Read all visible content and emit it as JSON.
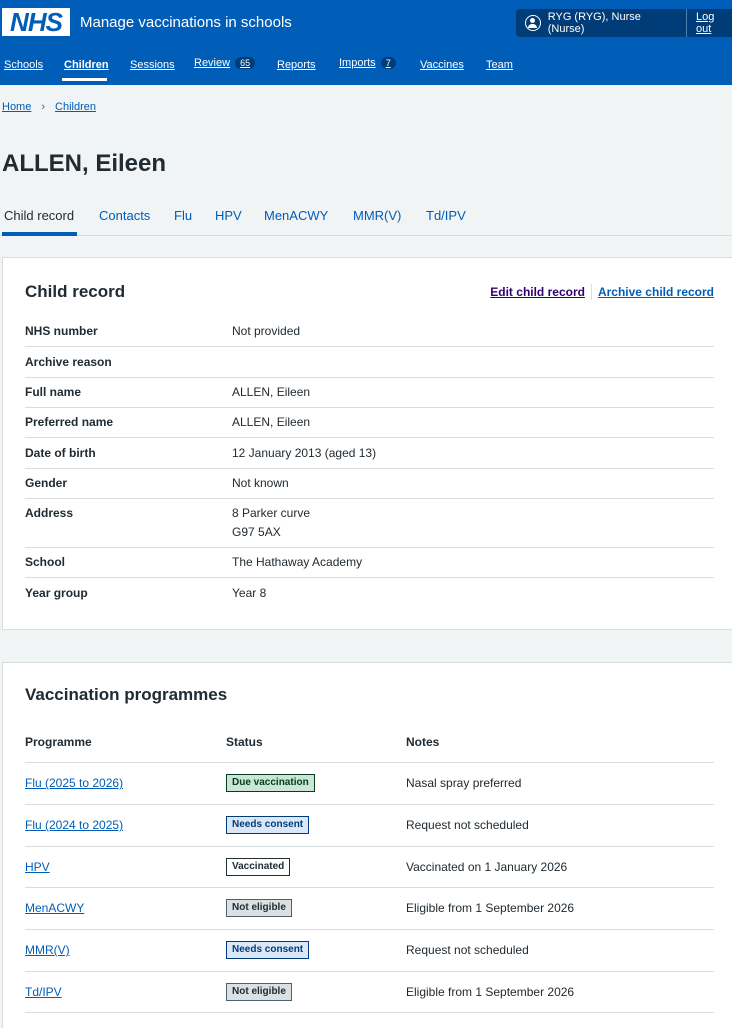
{
  "header": {
    "logo": "NHS",
    "service_name": "Manage vaccinations in schools",
    "account_name": "RYG (RYG), Nurse (Nurse)",
    "logout_label": "Log out"
  },
  "nav": {
    "items": [
      {
        "label": "Schools"
      },
      {
        "label": "Children"
      },
      {
        "label": "Sessions"
      },
      {
        "label": "Review",
        "count": "65"
      },
      {
        "label": "Reports"
      },
      {
        "label": "Imports",
        "count": "7"
      },
      {
        "label": "Vaccines"
      },
      {
        "label": "Team"
      }
    ]
  },
  "breadcrumb": {
    "home": "Home",
    "children": "Children"
  },
  "page_title": "ALLEN, Eileen",
  "tabs": [
    "Child record",
    "Contacts",
    "Flu",
    "HPV",
    "MenACWY",
    "MMR(V)",
    "Td/IPV"
  ],
  "child_record": {
    "title": "Child record",
    "edit_label": "Edit child record",
    "archive_label": "Archive child record",
    "rows": [
      {
        "key": "NHS number",
        "value": "Not provided"
      },
      {
        "key": "Archive reason",
        "value": ""
      },
      {
        "key": "Full name",
        "value": "ALLEN, Eileen"
      },
      {
        "key": "Preferred name",
        "value": "ALLEN, Eileen"
      },
      {
        "key": "Date of birth",
        "value": "12 January 2013 (aged 13)"
      },
      {
        "key": "Gender",
        "value": "Not known"
      },
      {
        "key": "Address",
        "value": "8 Parker curve",
        "value2": "G97 5AX"
      },
      {
        "key": "School",
        "value": "The Hathaway Academy"
      },
      {
        "key": "Year group",
        "value": "Year 8"
      }
    ]
  },
  "programmes": {
    "title": "Vaccination programmes",
    "headers": {
      "programme": "Programme",
      "status": "Status",
      "notes": "Notes"
    },
    "rows": [
      {
        "programme": "Flu (2025 to 2026)",
        "status": "Due vaccination",
        "notes": "Nasal spray preferred",
        "tag_color": "#cce5d6"
      },
      {
        "programme": "Flu (2024 to 2025)",
        "status": "Needs consent",
        "notes": "Request not scheduled",
        "tag_color": "#dbe6f6"
      },
      {
        "programme": "HPV",
        "status": "Vaccinated",
        "notes": "Vaccinated on 1 January 2026",
        "tag_color": "#ffffff"
      },
      {
        "programme": "MenACWY",
        "status": "Not eligible",
        "notes": "Eligible from 1 September 2026",
        "tag_color": "#dbe0e3"
      },
      {
        "programme": "MMR(V)",
        "status": "Needs consent",
        "notes": "Request not scheduled",
        "tag_color": "#dbe6f6"
      },
      {
        "programme": "Td/IPV",
        "status": "Not eligible",
        "notes": "Eligible from 1 September 2026",
        "tag_color": "#dbe0e3"
      }
    ]
  },
  "colors": {
    "brand": "#005eb8",
    "header_dark": "#003d78",
    "background": "#f0f4f5",
    "visited_link": "#330072"
  }
}
